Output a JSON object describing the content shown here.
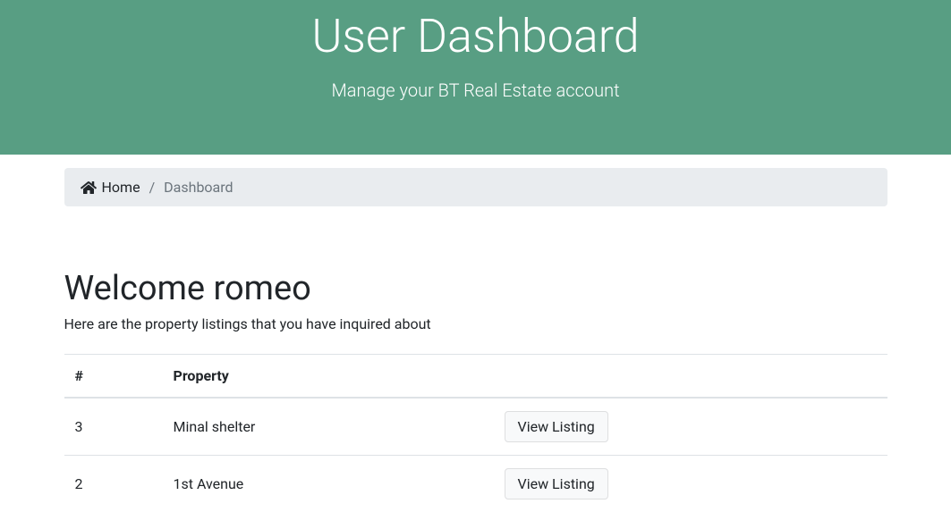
{
  "hero": {
    "title": "User Dashboard",
    "subtitle": "Manage your BT Real Estate account"
  },
  "breadcrumb": {
    "home_label": "Home",
    "current": "Dashboard"
  },
  "welcome": {
    "heading": "Welcome romeo",
    "lead": "Here are the property listings that you have inquired about"
  },
  "table": {
    "headers": {
      "id": "#",
      "property": "Property",
      "action": ""
    },
    "rows": [
      {
        "id": "3",
        "property": "Minal shelter",
        "action_label": "View Listing"
      },
      {
        "id": "2",
        "property": "1st Avenue",
        "action_label": "View Listing"
      }
    ]
  }
}
